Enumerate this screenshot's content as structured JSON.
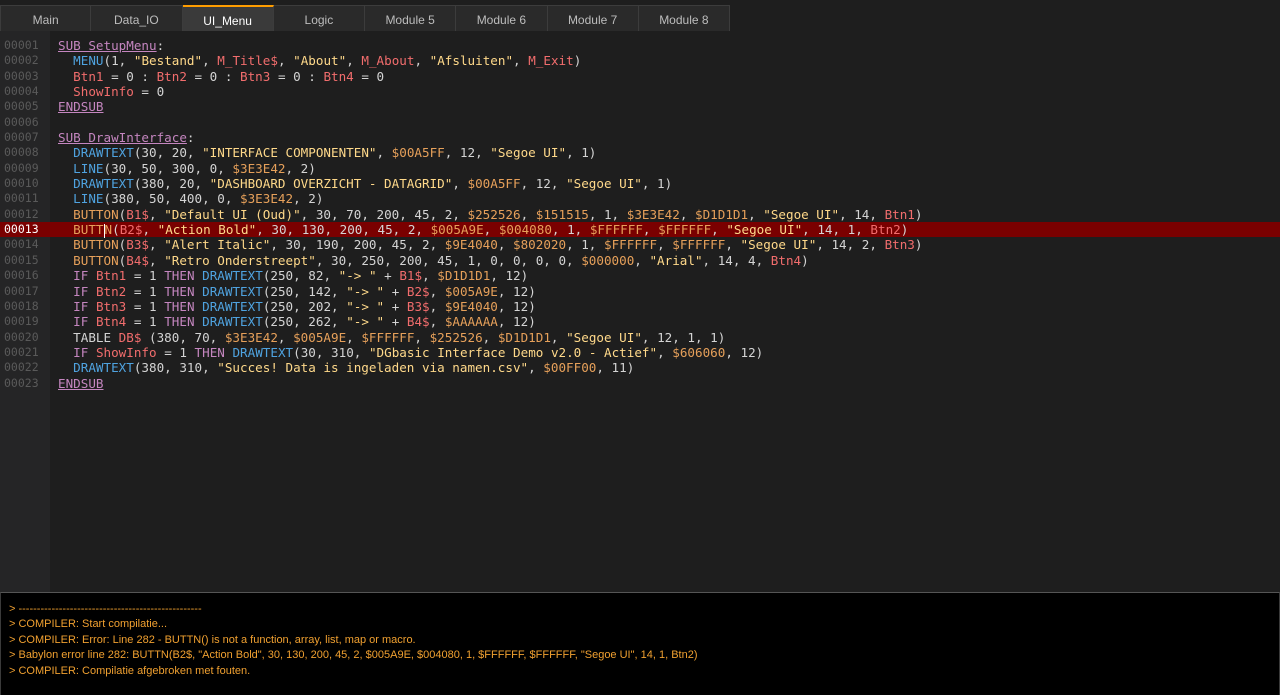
{
  "tabs": [
    {
      "label": "Main",
      "active": false
    },
    {
      "label": "Data_IO",
      "active": false
    },
    {
      "label": "UI_Menu",
      "active": true
    },
    {
      "label": "Logic",
      "active": false
    },
    {
      "label": "Module 5",
      "active": false
    },
    {
      "label": "Module 6",
      "active": false
    },
    {
      "label": "Module 7",
      "active": false
    },
    {
      "label": "Module 8",
      "active": false
    }
  ],
  "colors": {
    "keyword": "#c586c0",
    "function": "#4fa3e0",
    "variable": "#f26d6d",
    "string": "#ffd98a",
    "hex": "#e6a05a",
    "error_line": "#7a0000",
    "console_text": "#f0a030",
    "active_tab_accent": "#ff9d00"
  },
  "editor": {
    "error_line": 13,
    "lines": [
      {
        "n": "00001",
        "tokens": [
          [
            "kw-sub",
            "SUB SetupMenu"
          ],
          [
            "punct",
            ":"
          ]
        ]
      },
      {
        "n": "00002",
        "tokens": [
          [
            "punct",
            "  "
          ],
          [
            "fn",
            "MENU"
          ],
          [
            "punct",
            "(1, "
          ],
          [
            "str",
            "\"Bestand\""
          ],
          [
            "punct",
            ", "
          ],
          [
            "var",
            "M_Title$"
          ],
          [
            "punct",
            ", "
          ],
          [
            "str",
            "\"About\""
          ],
          [
            "punct",
            ", "
          ],
          [
            "var",
            "M_About"
          ],
          [
            "punct",
            ", "
          ],
          [
            "str",
            "\"Afsluiten\""
          ],
          [
            "punct",
            ", "
          ],
          [
            "var",
            "M_Exit"
          ],
          [
            "punct",
            ")"
          ]
        ]
      },
      {
        "n": "00003",
        "tokens": [
          [
            "punct",
            "  "
          ],
          [
            "var",
            "Btn1"
          ],
          [
            "punct",
            " = 0 : "
          ],
          [
            "var",
            "Btn2"
          ],
          [
            "punct",
            " = 0 : "
          ],
          [
            "var",
            "Btn3"
          ],
          [
            "punct",
            " = 0 : "
          ],
          [
            "var",
            "Btn4"
          ],
          [
            "punct",
            " = 0"
          ]
        ]
      },
      {
        "n": "00004",
        "tokens": [
          [
            "punct",
            "  "
          ],
          [
            "var",
            "ShowInfo"
          ],
          [
            "punct",
            " = 0"
          ]
        ]
      },
      {
        "n": "00005",
        "tokens": [
          [
            "kw-sub",
            "ENDSUB"
          ]
        ]
      },
      {
        "n": "00006",
        "tokens": []
      },
      {
        "n": "00007",
        "tokens": [
          [
            "kw-sub",
            "SUB DrawInterface"
          ],
          [
            "punct",
            ":"
          ]
        ]
      },
      {
        "n": "00008",
        "tokens": [
          [
            "punct",
            "  "
          ],
          [
            "fn",
            "DRAWTEXT"
          ],
          [
            "punct",
            "(30, 20, "
          ],
          [
            "str",
            "\"INTERFACE COMPONENTEN\""
          ],
          [
            "punct",
            ", "
          ],
          [
            "hex",
            "$00A5FF"
          ],
          [
            "punct",
            ", 12, "
          ],
          [
            "str",
            "\"Segoe UI\""
          ],
          [
            "punct",
            ", 1)"
          ]
        ]
      },
      {
        "n": "00009",
        "tokens": [
          [
            "punct",
            "  "
          ],
          [
            "fn",
            "LINE"
          ],
          [
            "punct",
            "(30, 50, 300, 0, "
          ],
          [
            "hex",
            "$3E3E42"
          ],
          [
            "punct",
            ", 2)"
          ]
        ]
      },
      {
        "n": "00010",
        "tokens": [
          [
            "punct",
            "  "
          ],
          [
            "fn",
            "DRAWTEXT"
          ],
          [
            "punct",
            "(380, 20, "
          ],
          [
            "str",
            "\"DASHBOARD OVERZICHT - DATAGRID\""
          ],
          [
            "punct",
            ", "
          ],
          [
            "hex",
            "$00A5FF"
          ],
          [
            "punct",
            ", 12, "
          ],
          [
            "str",
            "\"Segoe UI\""
          ],
          [
            "punct",
            ", 1)"
          ]
        ]
      },
      {
        "n": "00011",
        "tokens": [
          [
            "punct",
            "  "
          ],
          [
            "fn",
            "LINE"
          ],
          [
            "punct",
            "(380, 50, 400, 0, "
          ],
          [
            "hex",
            "$3E3E42"
          ],
          [
            "punct",
            ", 2)"
          ]
        ]
      },
      {
        "n": "00012",
        "tokens": [
          [
            "punct",
            "  "
          ],
          [
            "hex",
            "BUTTON"
          ],
          [
            "punct",
            "("
          ],
          [
            "var",
            "B1$"
          ],
          [
            "punct",
            ", "
          ],
          [
            "str",
            "\"Default UI (Oud)\""
          ],
          [
            "punct",
            ", 30, 70, 200, 45, 2, "
          ],
          [
            "hex",
            "$252526"
          ],
          [
            "punct",
            ", "
          ],
          [
            "hex",
            "$151515"
          ],
          [
            "punct",
            ", 1, "
          ],
          [
            "hex",
            "$3E3E42"
          ],
          [
            "punct",
            ", "
          ],
          [
            "hex",
            "$D1D1D1"
          ],
          [
            "punct",
            ", "
          ],
          [
            "str",
            "\"Segoe UI\""
          ],
          [
            "punct",
            ", 14, "
          ],
          [
            "var",
            "Btn1"
          ],
          [
            "punct",
            ")"
          ]
        ]
      },
      {
        "n": "00013",
        "tokens": [
          [
            "punct",
            "  "
          ],
          [
            "hex",
            "BUTT"
          ],
          [
            "caret",
            ""
          ],
          [
            "hex",
            "N"
          ],
          [
            "punct",
            "("
          ],
          [
            "var",
            "B2$"
          ],
          [
            "punct",
            ", "
          ],
          [
            "str",
            "\"Action Bold\""
          ],
          [
            "punct",
            ", 30, 130, 200, 45, 2, "
          ],
          [
            "hex",
            "$005A9E"
          ],
          [
            "punct",
            ", "
          ],
          [
            "hex",
            "$004080"
          ],
          [
            "punct",
            ", 1, "
          ],
          [
            "hex",
            "$FFFFFF"
          ],
          [
            "punct",
            ", "
          ],
          [
            "hex",
            "$FFFFFF"
          ],
          [
            "punct",
            ", "
          ],
          [
            "str",
            "\"Segoe UI\""
          ],
          [
            "punct",
            ", 14, 1, "
          ],
          [
            "var",
            "Btn2"
          ],
          [
            "punct",
            ")"
          ]
        ]
      },
      {
        "n": "00014",
        "tokens": [
          [
            "punct",
            "  "
          ],
          [
            "hex",
            "BUTTON"
          ],
          [
            "punct",
            "("
          ],
          [
            "var",
            "B3$"
          ],
          [
            "punct",
            ", "
          ],
          [
            "str",
            "\"Alert Italic\""
          ],
          [
            "punct",
            ", 30, 190, 200, 45, 2, "
          ],
          [
            "hex",
            "$9E4040"
          ],
          [
            "punct",
            ", "
          ],
          [
            "hex",
            "$802020"
          ],
          [
            "punct",
            ", 1, "
          ],
          [
            "hex",
            "$FFFFFF"
          ],
          [
            "punct",
            ", "
          ],
          [
            "hex",
            "$FFFFFF"
          ],
          [
            "punct",
            ", "
          ],
          [
            "str",
            "\"Segoe UI\""
          ],
          [
            "punct",
            ", 14, 2, "
          ],
          [
            "var",
            "Btn3"
          ],
          [
            "punct",
            ")"
          ]
        ]
      },
      {
        "n": "00015",
        "tokens": [
          [
            "punct",
            "  "
          ],
          [
            "hex",
            "BUTTON"
          ],
          [
            "punct",
            "("
          ],
          [
            "var",
            "B4$"
          ],
          [
            "punct",
            ", "
          ],
          [
            "str",
            "\"Retro Onderstreept\""
          ],
          [
            "punct",
            ", 30, 250, 200, 45, 1, 0, 0, 0, 0, "
          ],
          [
            "hex",
            "$000000"
          ],
          [
            "punct",
            ", "
          ],
          [
            "str",
            "\"Arial\""
          ],
          [
            "punct",
            ", 14, 4, "
          ],
          [
            "var",
            "Btn4"
          ],
          [
            "punct",
            ")"
          ]
        ]
      },
      {
        "n": "00016",
        "tokens": [
          [
            "punct",
            "  "
          ],
          [
            "kw",
            "IF"
          ],
          [
            "punct",
            " "
          ],
          [
            "var",
            "Btn1"
          ],
          [
            "punct",
            " = 1 "
          ],
          [
            "kw",
            "THEN"
          ],
          [
            "punct",
            " "
          ],
          [
            "fn",
            "DRAWTEXT"
          ],
          [
            "punct",
            "(250, 82, "
          ],
          [
            "str",
            "\"-> \""
          ],
          [
            "punct",
            " + "
          ],
          [
            "var",
            "B1$"
          ],
          [
            "punct",
            ", "
          ],
          [
            "hex",
            "$D1D1D1"
          ],
          [
            "punct",
            ", 12)"
          ]
        ]
      },
      {
        "n": "00017",
        "tokens": [
          [
            "punct",
            "  "
          ],
          [
            "kw",
            "IF"
          ],
          [
            "punct",
            " "
          ],
          [
            "var",
            "Btn2"
          ],
          [
            "punct",
            " = 1 "
          ],
          [
            "kw",
            "THEN"
          ],
          [
            "punct",
            " "
          ],
          [
            "fn",
            "DRAWTEXT"
          ],
          [
            "punct",
            "(250, 142, "
          ],
          [
            "str",
            "\"-> \""
          ],
          [
            "punct",
            " + "
          ],
          [
            "var",
            "B2$"
          ],
          [
            "punct",
            ", "
          ],
          [
            "hex",
            "$005A9E"
          ],
          [
            "punct",
            ", 12)"
          ]
        ]
      },
      {
        "n": "00018",
        "tokens": [
          [
            "punct",
            "  "
          ],
          [
            "kw",
            "IF"
          ],
          [
            "punct",
            " "
          ],
          [
            "var",
            "Btn3"
          ],
          [
            "punct",
            " = 1 "
          ],
          [
            "kw",
            "THEN"
          ],
          [
            "punct",
            " "
          ],
          [
            "fn",
            "DRAWTEXT"
          ],
          [
            "punct",
            "(250, 202, "
          ],
          [
            "str",
            "\"-> \""
          ],
          [
            "punct",
            " + "
          ],
          [
            "var",
            "B3$"
          ],
          [
            "punct",
            ", "
          ],
          [
            "hex",
            "$9E4040"
          ],
          [
            "punct",
            ", 12)"
          ]
        ]
      },
      {
        "n": "00019",
        "tokens": [
          [
            "punct",
            "  "
          ],
          [
            "kw",
            "IF"
          ],
          [
            "punct",
            " "
          ],
          [
            "var",
            "Btn4"
          ],
          [
            "punct",
            " = 1 "
          ],
          [
            "kw",
            "THEN"
          ],
          [
            "punct",
            " "
          ],
          [
            "fn",
            "DRAWTEXT"
          ],
          [
            "punct",
            "(250, 262, "
          ],
          [
            "str",
            "\"-> \""
          ],
          [
            "punct",
            " + "
          ],
          [
            "var",
            "B4$"
          ],
          [
            "punct",
            ", "
          ],
          [
            "hex",
            "$AAAAAA"
          ],
          [
            "punct",
            ", 12)"
          ]
        ]
      },
      {
        "n": "00020",
        "tokens": [
          [
            "punct",
            "  TABLE "
          ],
          [
            "var",
            "DB$"
          ],
          [
            "punct",
            " (380, 70, "
          ],
          [
            "hex",
            "$3E3E42"
          ],
          [
            "punct",
            ", "
          ],
          [
            "hex",
            "$005A9E"
          ],
          [
            "punct",
            ", "
          ],
          [
            "hex",
            "$FFFFFF"
          ],
          [
            "punct",
            ", "
          ],
          [
            "hex",
            "$252526"
          ],
          [
            "punct",
            ", "
          ],
          [
            "hex",
            "$D1D1D1"
          ],
          [
            "punct",
            ", "
          ],
          [
            "str",
            "\"Segoe UI\""
          ],
          [
            "punct",
            ", 12, 1, 1)"
          ]
        ]
      },
      {
        "n": "00021",
        "tokens": [
          [
            "punct",
            "  "
          ],
          [
            "kw",
            "IF"
          ],
          [
            "punct",
            " "
          ],
          [
            "var",
            "ShowInfo"
          ],
          [
            "punct",
            " = 1 "
          ],
          [
            "kw",
            "THEN"
          ],
          [
            "punct",
            " "
          ],
          [
            "fn",
            "DRAWTEXT"
          ],
          [
            "punct",
            "(30, 310, "
          ],
          [
            "str",
            "\"DGbasic Interface Demo v2.0 - Actief\""
          ],
          [
            "punct",
            ", "
          ],
          [
            "hex",
            "$606060"
          ],
          [
            "punct",
            ", 12)"
          ]
        ]
      },
      {
        "n": "00022",
        "tokens": [
          [
            "punct",
            "  "
          ],
          [
            "fn",
            "DRAWTEXT"
          ],
          [
            "punct",
            "(380, 310, "
          ],
          [
            "str",
            "\"Succes! Data is ingeladen via namen.csv\""
          ],
          [
            "punct",
            ", "
          ],
          [
            "hex",
            "$00FF00"
          ],
          [
            "punct",
            ", 11)"
          ]
        ]
      },
      {
        "n": "00023",
        "tokens": [
          [
            "kw-sub",
            "ENDSUB"
          ]
        ]
      }
    ]
  },
  "console": {
    "lines": [
      "> --------------------------------------------------",
      "> COMPILER: Start compilatie...",
      "> COMPILER: Error: Line 282 - BUTTN() is not a function, array, list, map or macro.",
      "> Babylon error line 282: BUTTN(B2$, \"Action Bold\", 30, 130, 200, 45, 2, $005A9E, $004080, 1, $FFFFFF, $FFFFFF, \"Segoe UI\", 14, 1, Btn2)",
      "> COMPILER: Compilatie afgebroken met fouten."
    ]
  }
}
